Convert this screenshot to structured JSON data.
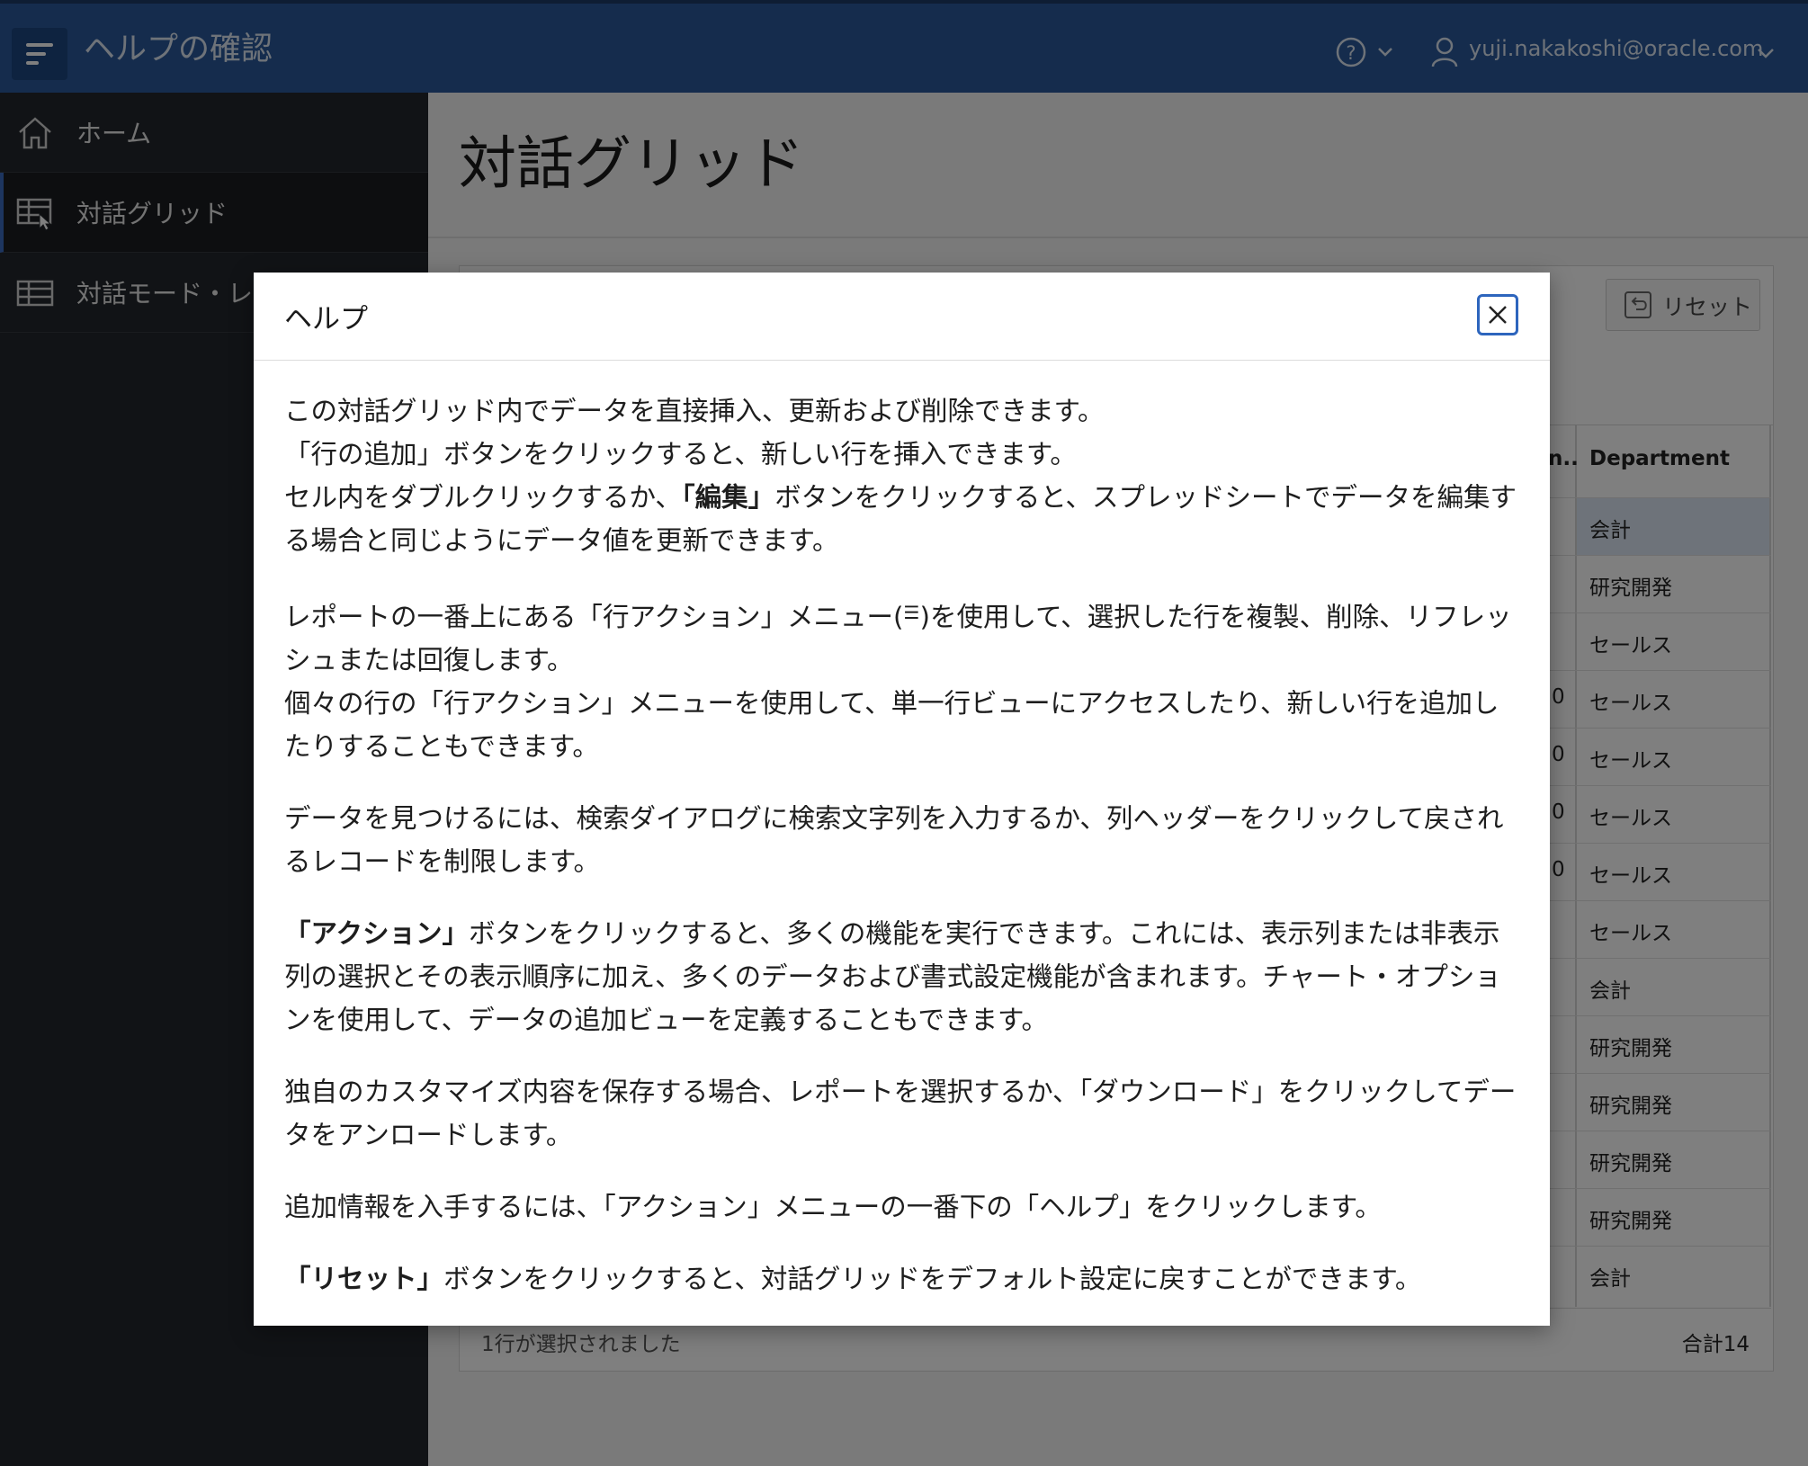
{
  "header": {
    "app_title": "ヘルプの確認",
    "user_name": "yuji.nakakoshi@oracle.com"
  },
  "sidebar": {
    "items": [
      {
        "label": "ホーム",
        "icon": "home-icon"
      },
      {
        "label": "対話グリッド",
        "icon": "interactive-grid-icon",
        "active": true
      },
      {
        "label": "対話モード・レ",
        "icon": "table-icon"
      }
    ]
  },
  "main": {
    "page_title": "対話グリッド",
    "reset_label": "リセット",
    "column_header": "Department",
    "column_header_left": "n..",
    "rows": [
      {
        "department": "会計",
        "left": ""
      },
      {
        "department": "研究開発",
        "left": ""
      },
      {
        "department": "セールス",
        "left": ""
      },
      {
        "department": "セールス",
        "left": "0"
      },
      {
        "department": "セールス",
        "left": "0"
      },
      {
        "department": "セールス",
        "left": "0"
      },
      {
        "department": "セールス",
        "left": "0"
      },
      {
        "department": "セールス",
        "left": ""
      },
      {
        "department": "会計",
        "left": ""
      },
      {
        "department": "研究開発",
        "left": ""
      },
      {
        "department": "研究開発",
        "left": ""
      },
      {
        "department": "研究開発",
        "left": ""
      },
      {
        "department": "研究開発",
        "left": ""
      },
      {
        "department": "会計",
        "left": ""
      }
    ],
    "footer_selected": "1行が選択されました",
    "footer_total": "合計14"
  },
  "dialog": {
    "title": "ヘルプ",
    "p1_line1": "この対話グリッド内でデータを直接挿入、更新および削除できます。",
    "p1_line2": "「行の追加」ボタンをクリックすると、新しい行を挿入できます。",
    "p1_line3_a": "セル内をダブルクリックするか、",
    "p1_line3_bold": "「編集」",
    "p1_line3_b": "ボタンをクリックすると、スプレッドシートでデータを編集する場合と同じようにデータ値を更新できます。",
    "p2_a": "レポートの一番上にある「行アクション」メニュー(",
    "p2_icon": "☰",
    "p2_b": ")を使用して、選択した行を複製、削除、リフレッシュまたは回復します。",
    "p2_line2": "個々の行の「行アクション」メニューを使用して、単一行ビューにアクセスしたり、新しい行を追加したりすることもできます。",
    "p3": "データを見つけるには、検索ダイアログに検索文字列を入力するか、列ヘッダーをクリックして戻されるレコードを制限します。",
    "p4_bold": "「アクション」",
    "p4": "ボタンをクリックすると、多くの機能を実行できます。これには、表示列または非表示列の選択とその表示順序に加え、多くのデータおよび書式設定機能が含まれます。チャート・オプションを使用して、データの追加ビューを定義することもできます。",
    "p5": "独自のカスタマイズ内容を保存する場合、レポートを選択するか、「ダウンロード」をクリックしてデータをアンロードします。",
    "p6": "追加情報を入手するには、「アクション」メニューの一番下の「ヘルプ」をクリックします。",
    "p7_bold": "「リセット」",
    "p7": "ボタンをクリックすると、対話グリッドをデフォルト設定に戻すことができます。"
  }
}
